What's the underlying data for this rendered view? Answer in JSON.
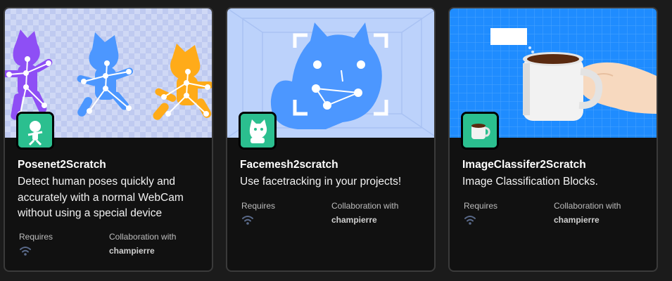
{
  "cards": [
    {
      "title": "Posenet2Scratch",
      "description": "Detect human poses quickly and accurately with a normal WebCam without using a special device",
      "requires_label": "Requires",
      "requires_icon": "wifi-icon",
      "collab_label": "Collaboration with",
      "collaborator": "champierre",
      "hero_colors": [
        "#cfd8f5",
        "#8e4ff5",
        "#4c97ff",
        "#ffab19"
      ]
    },
    {
      "title": "Facemesh2scratch",
      "description": "Use facetracking in your projects!",
      "requires_label": "Requires",
      "requires_icon": "wifi-icon",
      "collab_label": "Collaboration with",
      "collaborator": "champierre",
      "hero_colors": [
        "#bcd2fb",
        "#4c97ff"
      ]
    },
    {
      "title": "ImageClassifer2Scratch",
      "description": "Image Classification Blocks.",
      "requires_label": "Requires",
      "requires_icon": "wifi-icon",
      "collab_label": "Collaboration with",
      "collaborator": "champierre",
      "hero_colors": [
        "#1f8cff",
        "#f2f2f2"
      ]
    }
  ],
  "colors": {
    "badge": "#2bbf8f",
    "card_bg": "#111111",
    "card_border": "#3a3a3a"
  }
}
